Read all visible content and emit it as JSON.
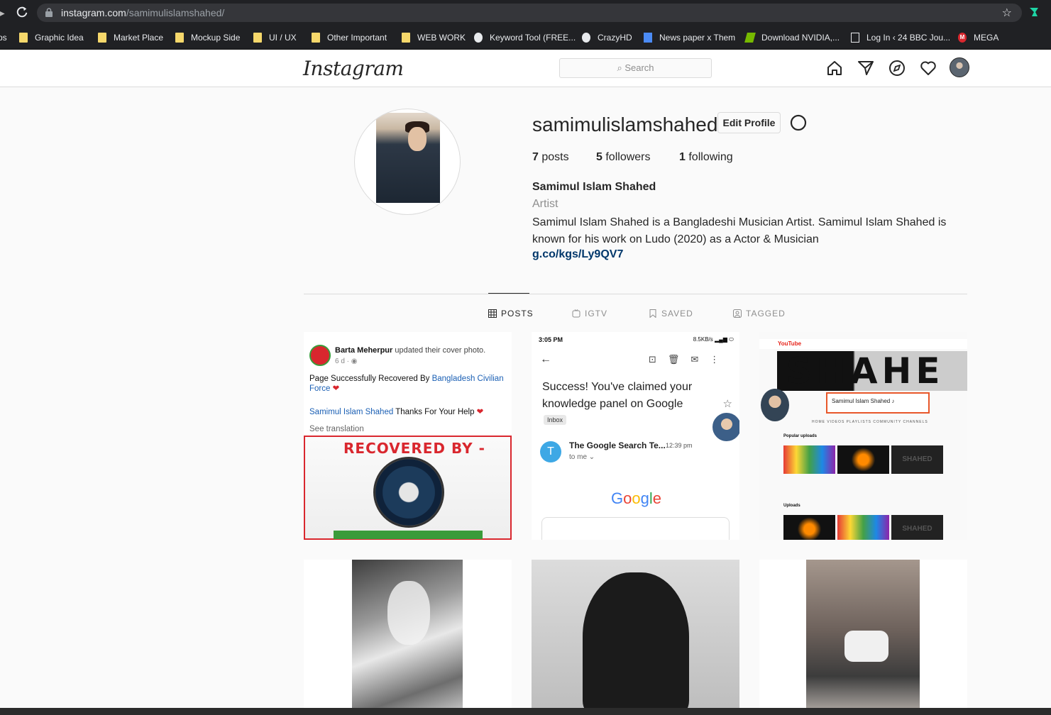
{
  "browser": {
    "url_domain": "instagram.com",
    "url_path": "/samimulislamshahed/",
    "bookmarks": [
      {
        "label": "Graphic Idea",
        "icon": "folder-icon"
      },
      {
        "label": "Market Place",
        "icon": "folder-icon"
      },
      {
        "label": "Mockup Side",
        "icon": "folder-icon"
      },
      {
        "label": "UI / UX",
        "icon": "folder-icon"
      },
      {
        "label": "Other Important",
        "icon": "folder-icon"
      },
      {
        "label": "WEB WORK",
        "icon": "folder-icon"
      },
      {
        "label": "Keyword Tool (FREE...",
        "icon": "globe-icon"
      },
      {
        "label": "CrazyHD",
        "icon": "globe-icon"
      },
      {
        "label": "News paper x Them",
        "icon": "doc-icon"
      },
      {
        "label": "Download NVIDIA,...",
        "icon": "nvidia-icon"
      },
      {
        "label": "Log In ‹ 24 BBC Jou...",
        "icon": "bbc-icon"
      },
      {
        "label": "MEGA",
        "icon": "mega-icon"
      }
    ],
    "bookmarks_prefix": "ps"
  },
  "header": {
    "logo": "Instagram",
    "search_placeholder": "Search"
  },
  "profile": {
    "username": "samimulislamshahed",
    "edit_profile": "Edit Profile",
    "posts_count": "7",
    "posts_label": "posts",
    "followers_count": "5",
    "followers_label": "followers",
    "following_count": "1",
    "following_label": "following",
    "full_name": "Samimul Islam Shahed",
    "category": "Artist",
    "bio": "Samimul Islam Shahed is a Bangladeshi Musician Artist. Samimul Islam Shahed is known for his work on Ludo (2020) as a Actor & Musician",
    "link": "g.co/kgs/Ly9QV7"
  },
  "tabs": [
    {
      "label": "POSTS",
      "active": true
    },
    {
      "label": "IGTV",
      "active": false
    },
    {
      "label": "SAVED",
      "active": false
    },
    {
      "label": "TAGGED",
      "active": false
    }
  ],
  "posts": {
    "p1": {
      "page_name": "Barta Meherpur",
      "action": "updated their cover photo.",
      "time": "6 d ·",
      "line1": "Page Successfully Recovered By ",
      "line1_link": "Bangladesh Civilian Force",
      "line2_link": "Samimul Islam Shahed",
      "line2": " Thanks For Your Help",
      "see_translation": "See translation",
      "banner_title": "RECOVERED BY -"
    },
    "p2": {
      "status_time": "3:05 PM",
      "status_right": "8.5KB/s",
      "subject": "Success! You've claimed your knowledge panel on Google",
      "inbox": "Inbox",
      "sender_initial": "T",
      "sender": "The Google Search Te...",
      "time": "12:39 pm",
      "to_me": "to me",
      "google": "Google"
    },
    "p3": {
      "yt_logo": "YouTube",
      "banner_text": "SHAHE",
      "channel_name": "Samimul Islam Shahed ♪",
      "tabs": "HOME   VIDEOS   PLAYLISTS   COMMUNITY   CHANNELS",
      "popular": "Popular uploads",
      "uploads": "Uploads",
      "thumb_c": "SHAHED"
    }
  }
}
